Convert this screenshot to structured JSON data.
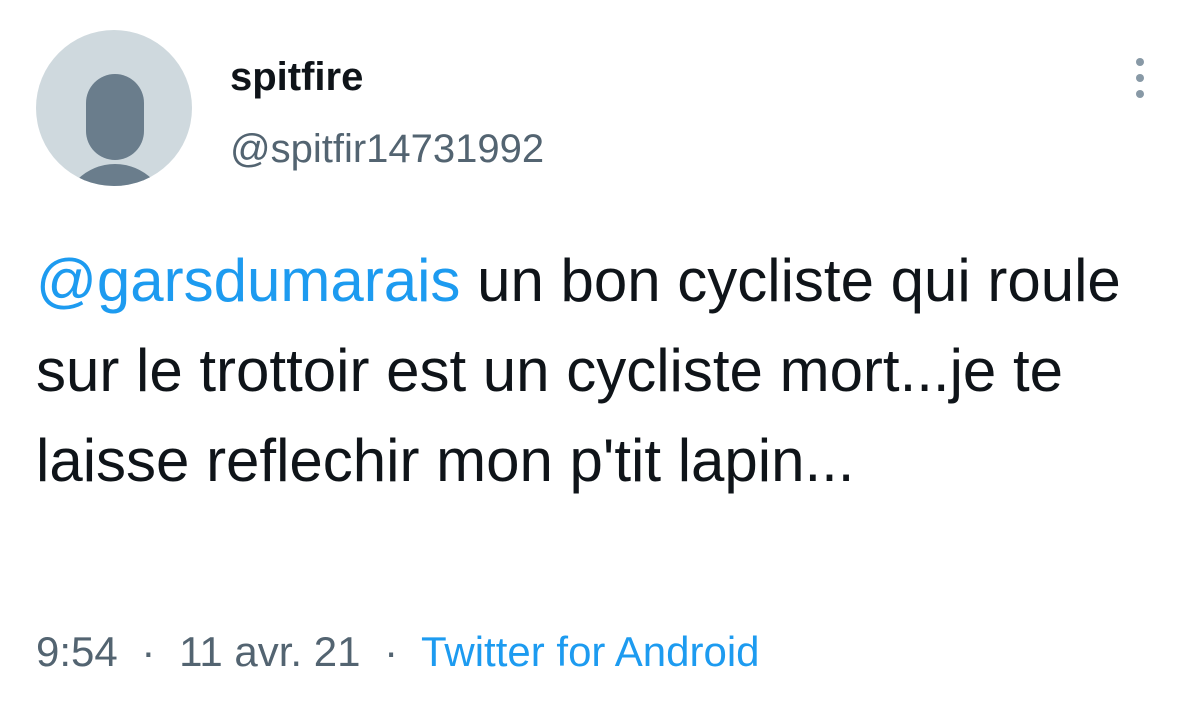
{
  "tweet": {
    "author": {
      "display_name": "spitfire",
      "handle": "@spitfir14731992",
      "avatar_icon": "default-profile-avatar-icon"
    },
    "more_icon": "vertical-ellipsis-icon",
    "mention": "@garsdumarais",
    "text": " un bon cycliste qui roule sur le trottoir est un cycliste mort...je te laisse reflechir mon p'tit lapin...",
    "time": "9:54",
    "separator": "·",
    "date": "11 avr. 21",
    "source": "Twitter for Android"
  },
  "colors": {
    "link": "#1d9bf0",
    "text": "#0f1419",
    "secondary": "#536471",
    "avatar_bg": "#cfd9de",
    "avatar_fg": "#6a7d8c"
  }
}
